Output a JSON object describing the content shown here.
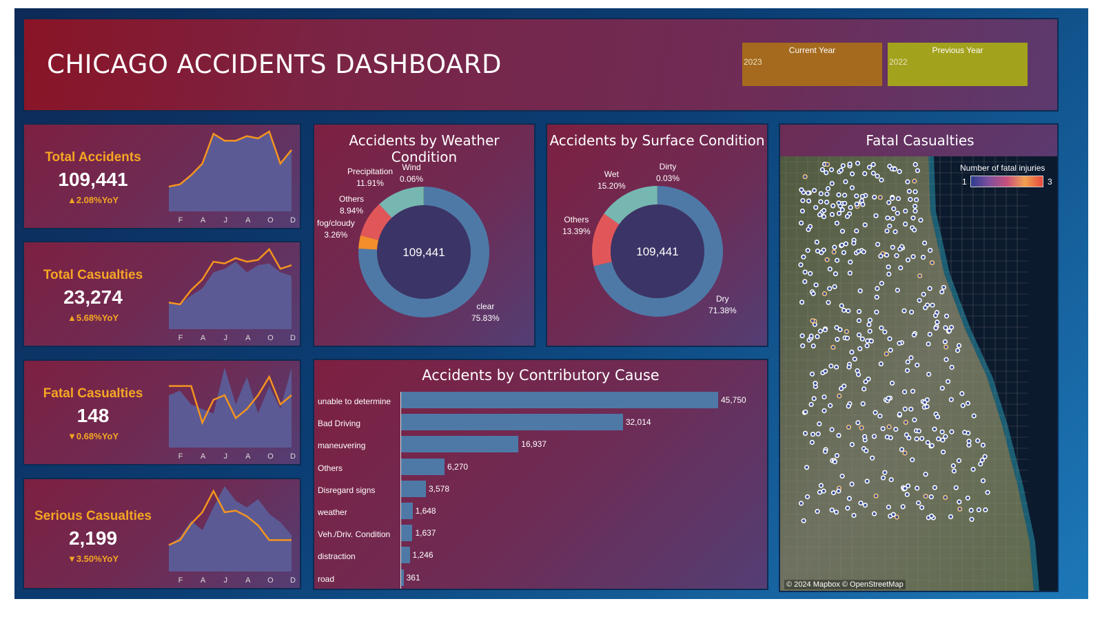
{
  "header": {
    "title": "CHICAGO ACCIDENTS DASHBOARD",
    "current_year_label": "Current Year",
    "current_year_value": "2023",
    "previous_year_label": "Previous Year",
    "previous_year_value": "2022"
  },
  "kpis": [
    {
      "title": "Total Accidents",
      "value": "109,441",
      "change": "▲2.08%YoY",
      "months": [
        "F",
        "A",
        "J",
        "A",
        "O",
        "D"
      ],
      "current": [
        62,
        63,
        67,
        72,
        85,
        82,
        82,
        84,
        83,
        86,
        72,
        78
      ],
      "previous": [
        62,
        63,
        67,
        72,
        85,
        82,
        82,
        84,
        83,
        86,
        72,
        78
      ]
    },
    {
      "title": "Total Casualties",
      "value": "23,274",
      "change": "▲5.68%YoY",
      "months": [
        "F",
        "A",
        "J",
        "A",
        "O",
        "D"
      ],
      "current": [
        55,
        54,
        62,
        68,
        78,
        77,
        80,
        78,
        79,
        85,
        74,
        76
      ],
      "previous": [
        55,
        54,
        59,
        63,
        72,
        74,
        78,
        72,
        76,
        77,
        72,
        70
      ]
    },
    {
      "title": "Fatal  Casualties",
      "value": "148",
      "change": "▼0.68%YoY",
      "months": [
        "F",
        "A",
        "J",
        "A",
        "O",
        "D"
      ],
      "current": [
        14,
        14,
        14,
        6,
        11,
        12,
        7,
        9,
        12,
        16,
        10,
        12
      ],
      "previous": [
        12,
        13,
        10,
        9,
        8,
        18,
        10,
        16,
        8,
        14,
        9,
        18
      ]
    },
    {
      "title": "Serious Casualties",
      "value": "2,199",
      "change": "▼3.50%YoY",
      "months": [
        "F",
        "A",
        "J",
        "A",
        "O",
        "D"
      ],
      "current": [
        160,
        166,
        186,
        200,
        226,
        200,
        202,
        195,
        184,
        166,
        166,
        166
      ],
      "previous": [
        160,
        170,
        190,
        178,
        206,
        232,
        214,
        206,
        216,
        198,
        188,
        172
      ]
    }
  ],
  "weather": {
    "title": "Accidents by Weather Condition",
    "center": "109,441",
    "labels": {
      "precipitation": [
        "Precipitation",
        "11.91%"
      ],
      "wind": [
        "Wind",
        "0.06%"
      ],
      "others": [
        "Others",
        "8.94%"
      ],
      "fog": [
        "fog/cloudy",
        "3.26%"
      ],
      "clear": [
        "clear",
        "75.83%"
      ]
    }
  },
  "surface": {
    "title": "Accidents by Surface Condition",
    "center": "109,441",
    "labels": {
      "wet": [
        "Wet",
        "15.20%"
      ],
      "dirty": [
        "Dirty",
        "0.03%"
      ],
      "others": [
        "Others",
        "13.39%"
      ],
      "dry": [
        "Dry",
        "71.38%"
      ]
    }
  },
  "causes_title": "Accidents by  Contributory Cause",
  "map": {
    "title": "Fatal Casualties",
    "legend_title": "Number of  fatal injuries",
    "legend_min": "1",
    "legend_max": "3",
    "credit": "© 2024 Mapbox © OpenStreetMap"
  },
  "chart_data": [
    {
      "type": "pie",
      "title": "Accidents by Weather Condition",
      "categories": [
        "clear",
        "fog/cloudy",
        "Others",
        "Precipitation",
        "Wind"
      ],
      "values": [
        75.83,
        3.26,
        8.94,
        11.91,
        0.06
      ],
      "colors": [
        "#4e79a7",
        "#f28e2b",
        "#e15759",
        "#76b7b2",
        "#59a14f"
      ]
    },
    {
      "type": "pie",
      "title": "Accidents by Surface Condition",
      "categories": [
        "Dry",
        "Others",
        "Wet",
        "Dirty"
      ],
      "values": [
        71.38,
        13.39,
        15.2,
        0.03
      ],
      "colors": [
        "#4e79a7",
        "#e15759",
        "#76b7b2",
        "#59a14f"
      ]
    },
    {
      "type": "bar",
      "title": "Accidents by  Contributory Cause",
      "categories": [
        "unable to determine",
        "Bad Driving",
        "maneuvering",
        "Others",
        "Disregard signs",
        "weather",
        "Veh./Driv. Condition",
        "distraction",
        "road"
      ],
      "values": [
        45750,
        32014,
        16937,
        6270,
        3578,
        1648,
        1637,
        1246,
        361
      ],
      "value_labels": [
        "45,750",
        "32,014",
        "16,937",
        "6,270",
        "3,578",
        "1,648",
        "1,637",
        "1,246",
        "361"
      ]
    }
  ],
  "colors": {
    "accent": "#f5a623",
    "bar": "#4e79a7",
    "area": "#5c5a94",
    "line": "#f5941e"
  }
}
